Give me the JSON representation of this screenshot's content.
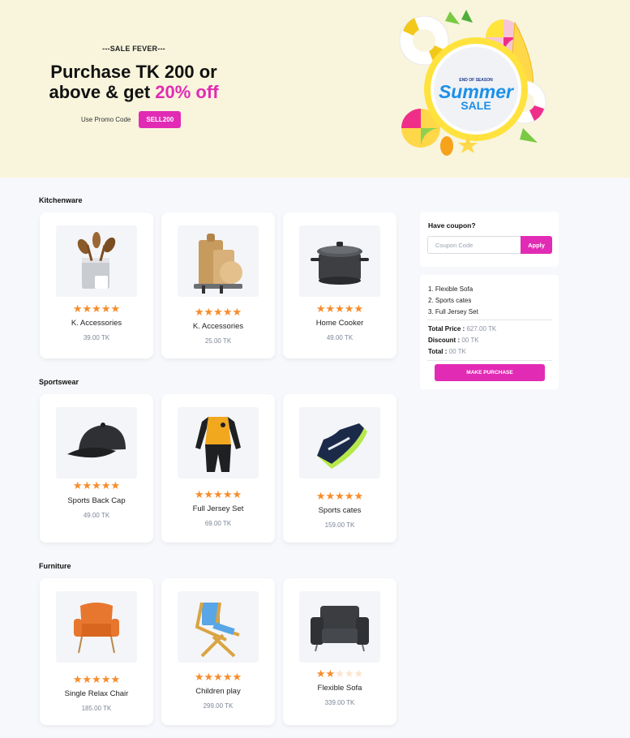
{
  "banner": {
    "kicker": "---SALE FEVER---",
    "headline_line1": "Purchase TK 200 or",
    "headline_line2_prefix": "above & get ",
    "headline_highlight": "20% off",
    "promo_label": "Use Promo Code",
    "promo_code": "SELL200",
    "graphic": {
      "top_text": "END OF SEASON",
      "main_text": "Summer",
      "sub_text": "SALE"
    }
  },
  "colors": {
    "accent": "#e22bb4",
    "star": "#f78c2a",
    "banner_bg": "#f8f5dc",
    "page_bg": "#f6f8fb"
  },
  "sections": [
    {
      "title": "Kitchenware",
      "products": [
        {
          "name": "K. Accessories",
          "price": "39.00 TK",
          "rating": 5,
          "icon": "kitchen-utensils-icon"
        },
        {
          "name": "K. Accessories",
          "price": "25.00 TK",
          "rating": 5,
          "icon": "cutting-boards-icon"
        },
        {
          "name": "Home Cooker",
          "price": "49.00 TK",
          "rating": 5,
          "icon": "cooking-pot-icon"
        }
      ]
    },
    {
      "title": "Sportswear",
      "products": [
        {
          "name": "Sports Back Cap",
          "price": "49.00 TK",
          "rating": 5,
          "icon": "cap-icon"
        },
        {
          "name": "Full Jersey Set",
          "price": "69.00 TK",
          "rating": 5,
          "icon": "jersey-icon"
        },
        {
          "name": "Sports cates",
          "price": "159.00 TK",
          "rating": 5,
          "icon": "sneaker-icon"
        }
      ]
    },
    {
      "title": "Furniture",
      "products": [
        {
          "name": "Single Relax Chair",
          "price": "185.00 TK",
          "rating": 5,
          "icon": "armchair-icon"
        },
        {
          "name": "Children play",
          "price": "299.00 TK",
          "rating": 5,
          "icon": "beach-chair-icon"
        },
        {
          "name": "Flexible Sofa",
          "price": "339.00 TK",
          "rating": 2,
          "icon": "sofa-icon"
        }
      ]
    }
  ],
  "coupon": {
    "title": "Have coupon?",
    "placeholder": "Coupon Code",
    "apply_label": "Apply"
  },
  "summary": {
    "items": [
      "1. Flexible Sofa",
      "2. Sports cates",
      "3. Full Jersey Set"
    ],
    "total_price_label": "Total Price :",
    "total_price_value": "627.00 TK",
    "discount_label": "Discount :",
    "discount_value": "00 TK",
    "total_label": "Total :",
    "total_value": "00 TK",
    "purchase_label": "MAKE PURCHASE"
  }
}
